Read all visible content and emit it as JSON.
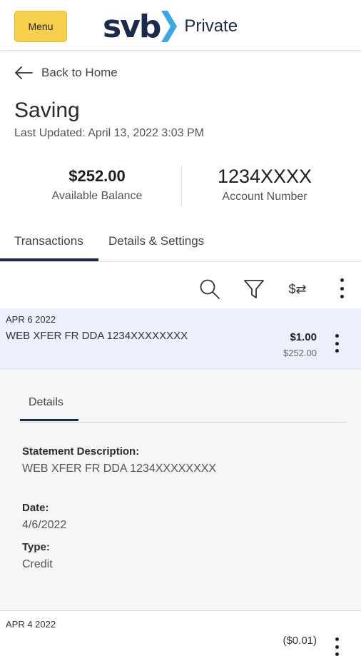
{
  "header": {
    "menu_label": "Menu",
    "logo_text": "svb",
    "logo_suffix": "Private"
  },
  "nav": {
    "back_label": "Back to Home"
  },
  "account": {
    "title": "Saving",
    "last_updated": "Last Updated: April 13, 2022 3:03 PM",
    "balance_value": "$252.00",
    "balance_label": "Available Balance",
    "account_number": "1234XXXX",
    "account_number_label": "Account Number"
  },
  "tabs": [
    {
      "label": "Transactions",
      "active": true
    },
    {
      "label": "Details & Settings",
      "active": false
    }
  ],
  "toolbar": {
    "icons": [
      "search-icon",
      "filter-icon",
      "sort-icon",
      "more-icon"
    ],
    "sort_glyph": "$⇄"
  },
  "transactions": [
    {
      "date": "APR 6 2022",
      "description": "WEB XFER FR DDA 1234XXXXXXXX",
      "amount": "$1.00",
      "running_balance": "$252.00"
    },
    {
      "date": "APR 4 2022",
      "amount": "($0.01)"
    }
  ],
  "details": {
    "tab_label": "Details",
    "statement_label": "Statement Description:",
    "statement_value": "WEB XFER FR DDA 1234XXXXXXXX",
    "date_label": "Date:",
    "date_value": "4/6/2022",
    "type_label": "Type:",
    "type_value": "Credit"
  },
  "colors": {
    "brand_navy": "#1a2b4a",
    "brand_chevron": "#3aa7e6",
    "menu_yellow": "#f6d04d",
    "selected_row": "#ecf0fb"
  }
}
